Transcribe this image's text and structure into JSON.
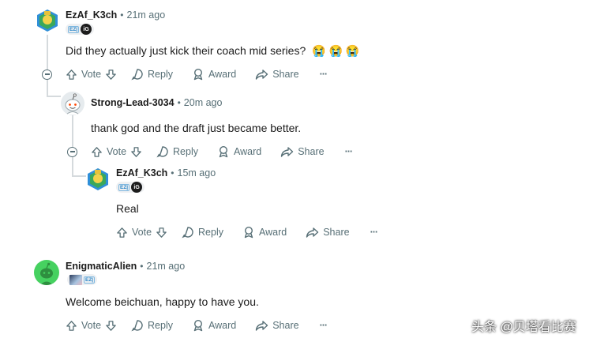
{
  "comments": [
    {
      "username": "EzAf_K3ch",
      "time": "21m ago",
      "flair_tag": "EZ|",
      "flair_logo": "iG",
      "text": "Did they actually just kick their coach mid series?",
      "emojis": "😭 😭 😭",
      "actions": {
        "vote": "Vote",
        "reply": "Reply",
        "award": "Award",
        "share": "Share",
        "more": "···"
      }
    },
    {
      "username": "Strong-Lead-3034",
      "time": "20m ago",
      "text": "thank god and the draft just became better.",
      "actions": {
        "vote": "Vote",
        "reply": "Reply",
        "award": "Award",
        "share": "Share",
        "more": "···"
      }
    },
    {
      "username": "EzAf_K3ch",
      "time": "15m ago",
      "flair_tag": "EZ|",
      "flair_logo": "iG",
      "text": "Real",
      "actions": {
        "vote": "Vote",
        "reply": "Reply",
        "award": "Award",
        "share": "Share",
        "more": "···"
      }
    },
    {
      "username": "EnigmaticAlien",
      "time": "21m ago",
      "flair_tag": "EZ|",
      "text": "Welcome beichuan, happy to have you.",
      "actions": {
        "vote": "Vote",
        "reply": "Reply",
        "award": "Award",
        "share": "Share",
        "more": "···"
      }
    }
  ],
  "separator": "•",
  "watermark": "头条 @贝塔看比赛",
  "colors": {
    "text": "#1c1c1c",
    "muted": "#576f76",
    "thread_line": "#d5dadd",
    "alien_green": "#46d160"
  }
}
